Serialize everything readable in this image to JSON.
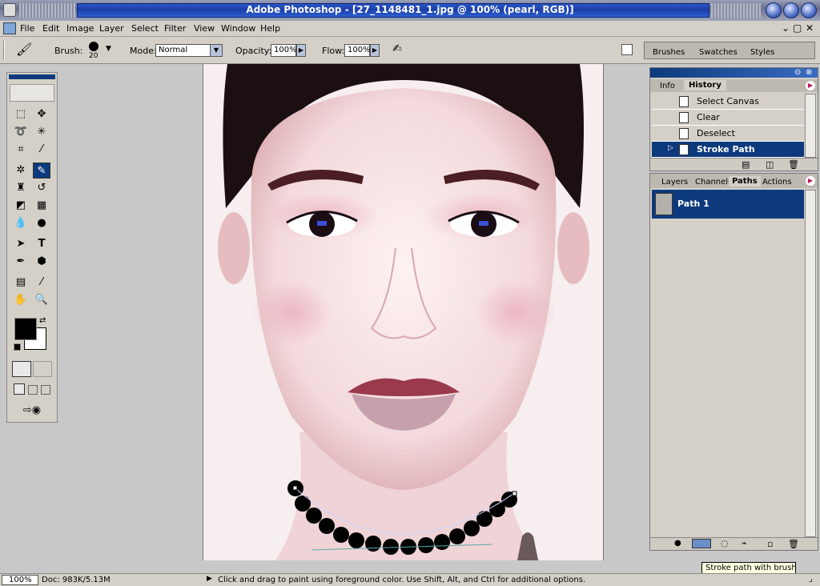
{
  "window": {
    "title": "Adobe Photoshop - [27_1148481_1.jpg @ 100% (pearl, RGB)]"
  },
  "menu": {
    "items": [
      "File",
      "Edit",
      "Image",
      "Layer",
      "Select",
      "Filter",
      "View",
      "Window",
      "Help"
    ]
  },
  "options": {
    "brush_label": "Brush:",
    "brush_size": "20",
    "mode_label": "Mode:",
    "mode_value": "Normal",
    "opacity_label": "Opacity:",
    "opacity_value": "100%",
    "flow_label": "Flow:",
    "flow_value": "100%"
  },
  "palette_well": {
    "tabs": [
      "Brushes",
      "Swatches",
      "Styles"
    ]
  },
  "history": {
    "tabs": [
      "Info",
      "History"
    ],
    "items": [
      {
        "label": "Select Canvas"
      },
      {
        "label": "Clear"
      },
      {
        "label": "Deselect"
      },
      {
        "label": "Stroke Path"
      }
    ],
    "selected": "Stroke Path"
  },
  "paths": {
    "tabs": [
      "Layers",
      "Channels",
      "Paths",
      "Actions"
    ],
    "items": [
      {
        "label": "Path 1"
      }
    ]
  },
  "status": {
    "zoom": "100%",
    "doc": "Doc: 983K/5.13M",
    "hint": "Click and drag to paint using foreground color.  Use Shift, Alt, and Ctrl for additional options."
  },
  "tooltip": {
    "text": "Stroke path with brush"
  },
  "colors": {
    "accent": "#0c3a7c",
    "title": "#1b3fa8",
    "foreground": "#000000",
    "background": "#ffffff"
  }
}
